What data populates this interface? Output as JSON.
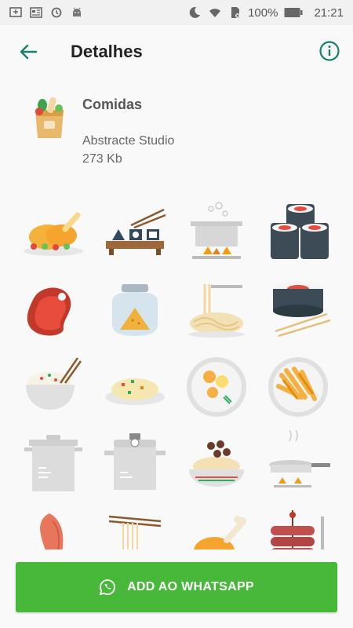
{
  "status_bar": {
    "battery": "100%",
    "time": "21:21",
    "icons_left": [
      "download-icon",
      "news-icon",
      "sync-icon",
      "android-icon"
    ],
    "icons_right": [
      "moon-icon",
      "wifi-icon",
      "sim-icon",
      "battery-icon"
    ]
  },
  "appbar": {
    "title": "Detalhes",
    "back_icon": "arrow-left-icon",
    "info_icon": "info-icon"
  },
  "pack": {
    "name": "Comidas",
    "author": "Abstracte Studio",
    "size": "273 Kb",
    "tray_icon": "grocery-bag-icon"
  },
  "stickers": [
    "roast-chicken",
    "sushi-board",
    "cooking-pot-steam",
    "sushi-rolls",
    "steak",
    "spice-jar",
    "noodle-fork",
    "maki-roll-chopsticks",
    "rice-bowl-chopsticks",
    "fried-rice-plate",
    "plate-eggs",
    "plate-fries",
    "stock-pot",
    "pressure-cooker",
    "spaghetti-meatballs",
    "frying-pan",
    "shrimp",
    "noodles-chopsticks",
    "chicken-leg",
    "sausages-skewer"
  ],
  "colors": {
    "accent": "#17806d",
    "button": "#47b83a"
  },
  "add_button": {
    "label": "ADD AO WHATSAPP",
    "icon": "whatsapp-icon"
  }
}
